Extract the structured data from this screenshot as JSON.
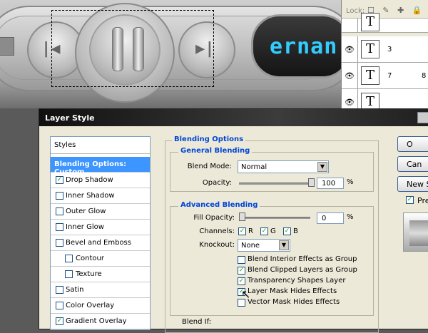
{
  "canvas": {
    "lcd_text": "ernan"
  },
  "layers_panel": {
    "lock_label": "Lock:",
    "lock_icons": "☐ ✎ ✚ 🔒",
    "layers": [
      {
        "thumb": "T",
        "name": "",
        "name2": ""
      },
      {
        "thumb": "T",
        "name": "3",
        "name2": ""
      },
      {
        "thumb": "T",
        "name": "7",
        "name2": "8"
      },
      {
        "thumb": "T",
        "name": "",
        "name2": ""
      }
    ]
  },
  "dialog": {
    "title": "Layer Style",
    "styles_header": "Styles",
    "style_items": [
      {
        "label": "Blending Options: Custom",
        "selected": true,
        "checked": null
      },
      {
        "label": "Drop Shadow",
        "checked": true
      },
      {
        "label": "Inner Shadow",
        "checked": false
      },
      {
        "label": "Outer Glow",
        "checked": false
      },
      {
        "label": "Inner Glow",
        "checked": false
      },
      {
        "label": "Bevel and Emboss",
        "checked": false
      },
      {
        "label": "Contour",
        "checked": false
      },
      {
        "label": "Texture",
        "checked": false
      },
      {
        "label": "Satin",
        "checked": false
      },
      {
        "label": "Color Overlay",
        "checked": false
      },
      {
        "label": "Gradient Overlay",
        "checked": true
      }
    ],
    "blending_options": {
      "title": "Blending Options",
      "general": {
        "title": "General Blending",
        "blend_mode_label": "Blend Mode:",
        "blend_mode_value": "Normal",
        "opacity_label": "Opacity:",
        "opacity_value": "100",
        "opacity_unit": "%"
      },
      "advanced": {
        "title": "Advanced Blending",
        "fill_opacity_label": "Fill Opacity:",
        "fill_opacity_value": "0",
        "fill_opacity_unit": "%",
        "channels_label": "Channels:",
        "channels": [
          {
            "label": "R",
            "checked": true
          },
          {
            "label": "G",
            "checked": true
          },
          {
            "label": "B",
            "checked": true
          }
        ],
        "knockout_label": "Knockout:",
        "knockout_value": "None",
        "options": [
          {
            "label": "Blend Interior Effects as Group",
            "checked": false
          },
          {
            "label": "Blend Clipped Layers as Group",
            "checked": true
          },
          {
            "label": "Transparency Shapes Layer",
            "checked": true
          },
          {
            "label": "Layer Mask Hides Effects",
            "checked": true
          },
          {
            "label": "Vector Mask Hides Effects",
            "checked": false
          }
        ],
        "blend_if_label": "Blend If:"
      }
    },
    "right_buttons": {
      "ok": "O",
      "cancel": "Can",
      "new_style": "New S",
      "preview_label": "Pre",
      "preview_checked": true
    }
  }
}
